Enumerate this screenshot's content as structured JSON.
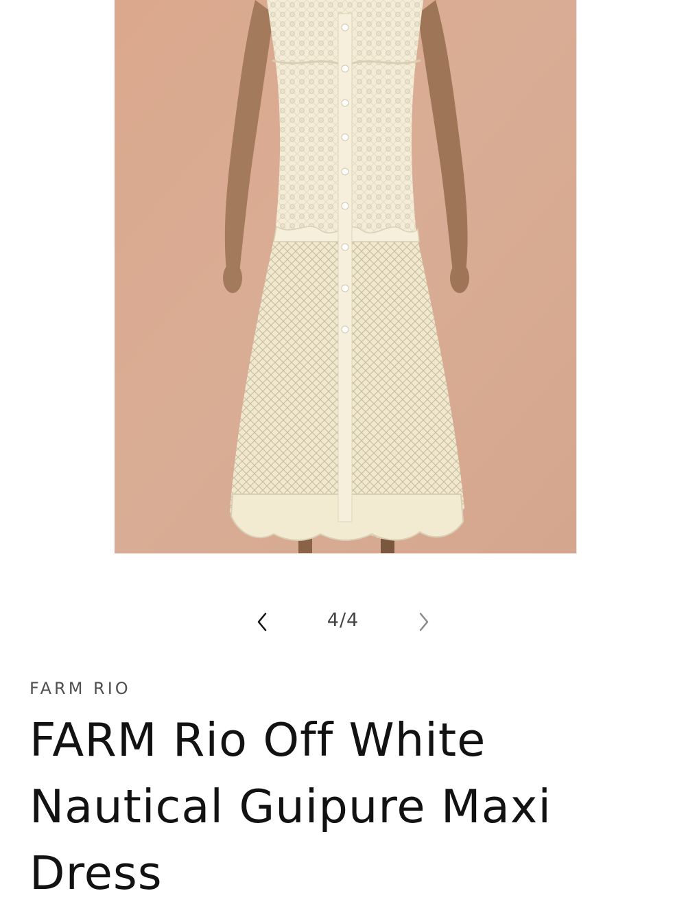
{
  "product": {
    "image_alt": "Off white guipure lace maxi dress with button front",
    "vendor": "FARM RIO",
    "title": "FARM Rio Off White Nautical Guipure Maxi Dress"
  },
  "gallery": {
    "counter": "4/4",
    "prev_icon": "chevron-left-icon",
    "next_icon": "chevron-right-icon"
  },
  "colors": {
    "background": "#d8ab92",
    "dress": "#f4ecd6",
    "skin": "#a47a5c",
    "text": "#121212",
    "muted_text": "#505050"
  }
}
